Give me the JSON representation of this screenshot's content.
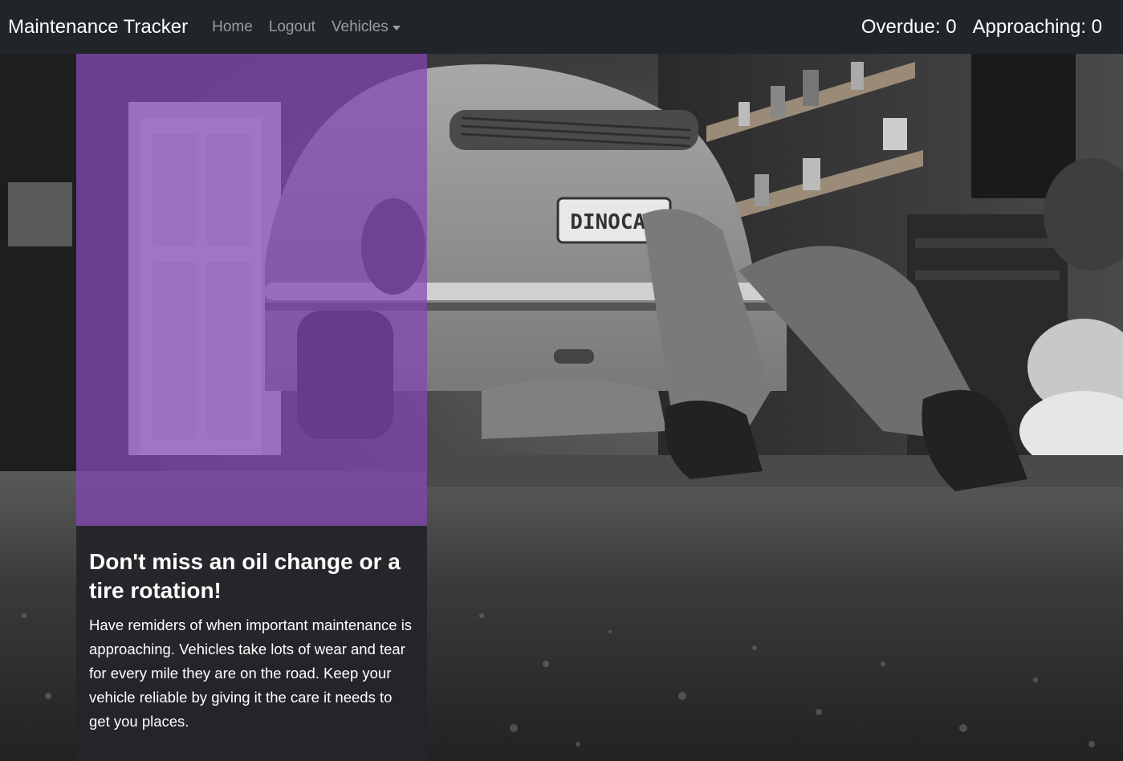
{
  "navbar": {
    "brand": "Maintenance Tracker",
    "links": [
      "Home",
      "Logout"
    ],
    "dropdown_label": "Vehicles",
    "overdue": "Overdue: 0",
    "approaching": "Approaching: 0"
  },
  "hero": {
    "image_text": "DINOCAR",
    "title": "Don't miss an oil change or a tire rotation!",
    "text": "Have remiders of when important maintenance is approaching. Vehicles take lots of wear and tear for every mile they are on the road. Keep your vehicle reliable by giving it the care it needs to get you places."
  },
  "colors": {
    "navbar_bg": "#212529",
    "accent_purple": "#8446b4",
    "text_panel_bg": "#242529"
  },
  "icons": {
    "vehicles_dropdown": "chevron-down-icon"
  }
}
